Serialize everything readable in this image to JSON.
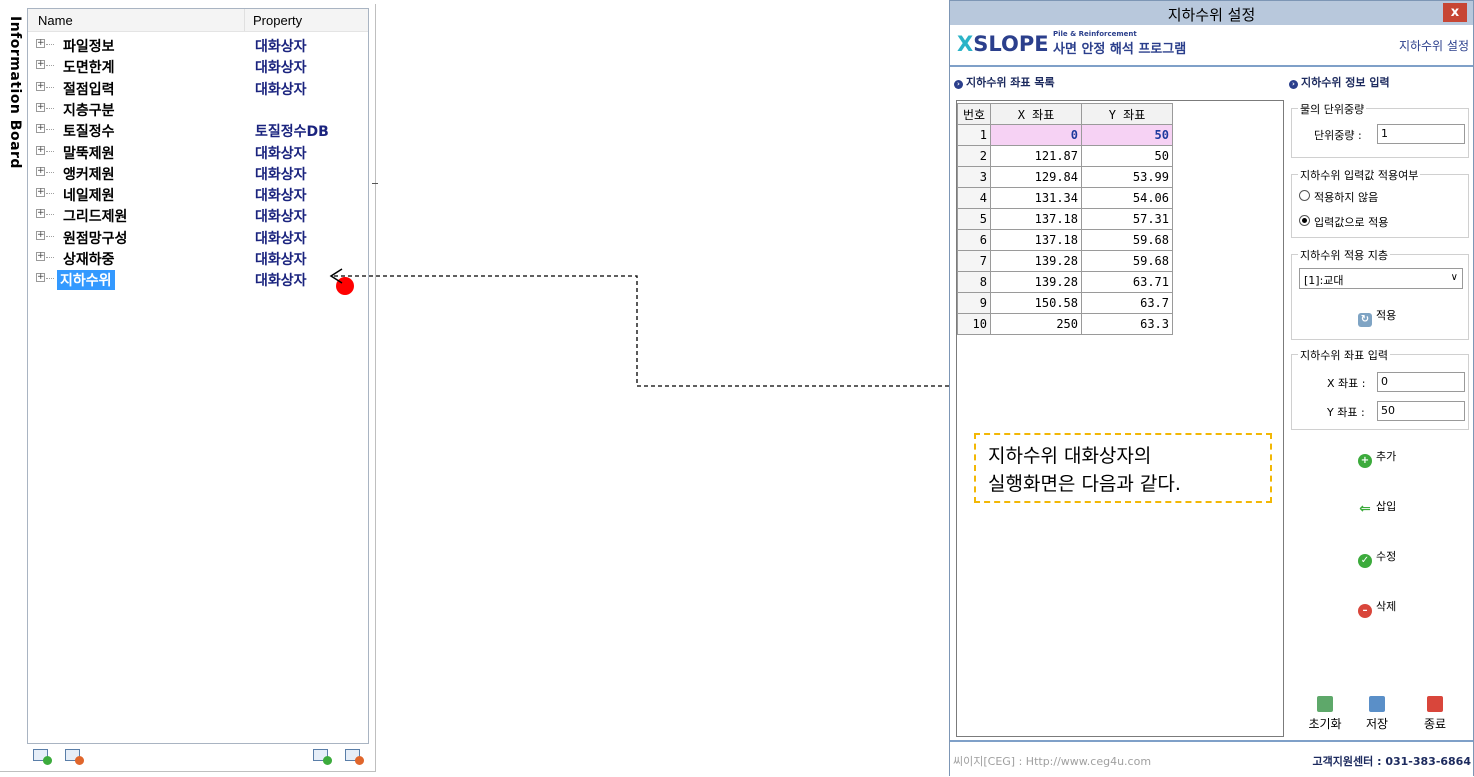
{
  "info_board": {
    "title": "Information Board",
    "header": {
      "name": "Name",
      "property": "Property"
    },
    "rows": [
      {
        "name": "파일정보",
        "property": "대화상자"
      },
      {
        "name": "도면한계",
        "property": "대화상자"
      },
      {
        "name": "절점입력",
        "property": "대화상자"
      },
      {
        "name": "지층구분",
        "property": ""
      },
      {
        "name": "토질정수",
        "property": "토질정수DB"
      },
      {
        "name": "말뚝제원",
        "property": "대화상자"
      },
      {
        "name": "앵커제원",
        "property": "대화상자"
      },
      {
        "name": "네일제원",
        "property": "대화상자"
      },
      {
        "name": "그리드제원",
        "property": "대화상자"
      },
      {
        "name": "원점망구성",
        "property": "대화상자"
      },
      {
        "name": "상재하중",
        "property": "대화상자"
      },
      {
        "name": "지하수위",
        "property": "대화상자",
        "selected": true
      }
    ],
    "expander_glyph": "+",
    "toolbar_icons": [
      "add-icon",
      "remove-icon",
      "add-row-icon",
      "remove-row-icon"
    ]
  },
  "dialog": {
    "title": "지하수위 설정",
    "close_label": "x",
    "logo": {
      "x": "X",
      "slope": "SLOPE",
      "tagline": "Pile & Reinforcement",
      "subtitle": "사면 안정 해석 프로그램"
    },
    "banner_right": "지하수위 설정",
    "list_heading": "지하수위 좌표 목록",
    "info_heading": "지하수위 정보 입력",
    "grid": {
      "columns": [
        "번호",
        "X 좌표",
        "Y 좌표"
      ],
      "rows": [
        {
          "no": "1",
          "x": "0",
          "y": "50"
        },
        {
          "no": "2",
          "x": "121.87",
          "y": "50"
        },
        {
          "no": "3",
          "x": "129.84",
          "y": "53.99"
        },
        {
          "no": "4",
          "x": "131.34",
          "y": "54.06"
        },
        {
          "no": "5",
          "x": "137.18",
          "y": "57.31"
        },
        {
          "no": "6",
          "x": "137.18",
          "y": "59.68"
        },
        {
          "no": "7",
          "x": "139.28",
          "y": "59.68"
        },
        {
          "no": "8",
          "x": "139.28",
          "y": "63.71"
        },
        {
          "no": "9",
          "x": "150.58",
          "y": "63.7"
        },
        {
          "no": "10",
          "x": "250",
          "y": "63.3"
        }
      ]
    },
    "unit_weight": {
      "legend": "물의 단위중량",
      "label": "단위중량 :",
      "value": "1"
    },
    "apply_input": {
      "legend": "지하수위 입력값 적용여부",
      "option_off": "적용하지 않음",
      "option_on": "입력값으로 적용"
    },
    "layer": {
      "legend": "지하수위 적용 지층",
      "selected": "[1]:교대",
      "apply_label": "적용"
    },
    "coord_input": {
      "legend": "지하수위 좌표 입력",
      "x_label": "X 좌표 :",
      "x_value": "0",
      "y_label": "Y 좌표 :",
      "y_value": "50"
    },
    "actions": {
      "add": "추가",
      "insert": "삽입",
      "edit": "수정",
      "delete": "삭제"
    },
    "bottom": {
      "reset": "초기화",
      "save": "저장",
      "exit": "종료"
    },
    "footer": {
      "left": "씨이지[CEG] : Http://www.ceg4u.com",
      "right": "고객지원센터 : 031-383-6864"
    }
  },
  "callout": {
    "line1": "지하수위 대화상자의",
    "line2": "실행화면은 다음과 같다."
  },
  "colors": {
    "selection": "#3399ff",
    "marker": "#ff0000",
    "callout_border": "#f2b705",
    "grid_selected": "#f6d2f4",
    "brand": "#2b3f8c"
  }
}
